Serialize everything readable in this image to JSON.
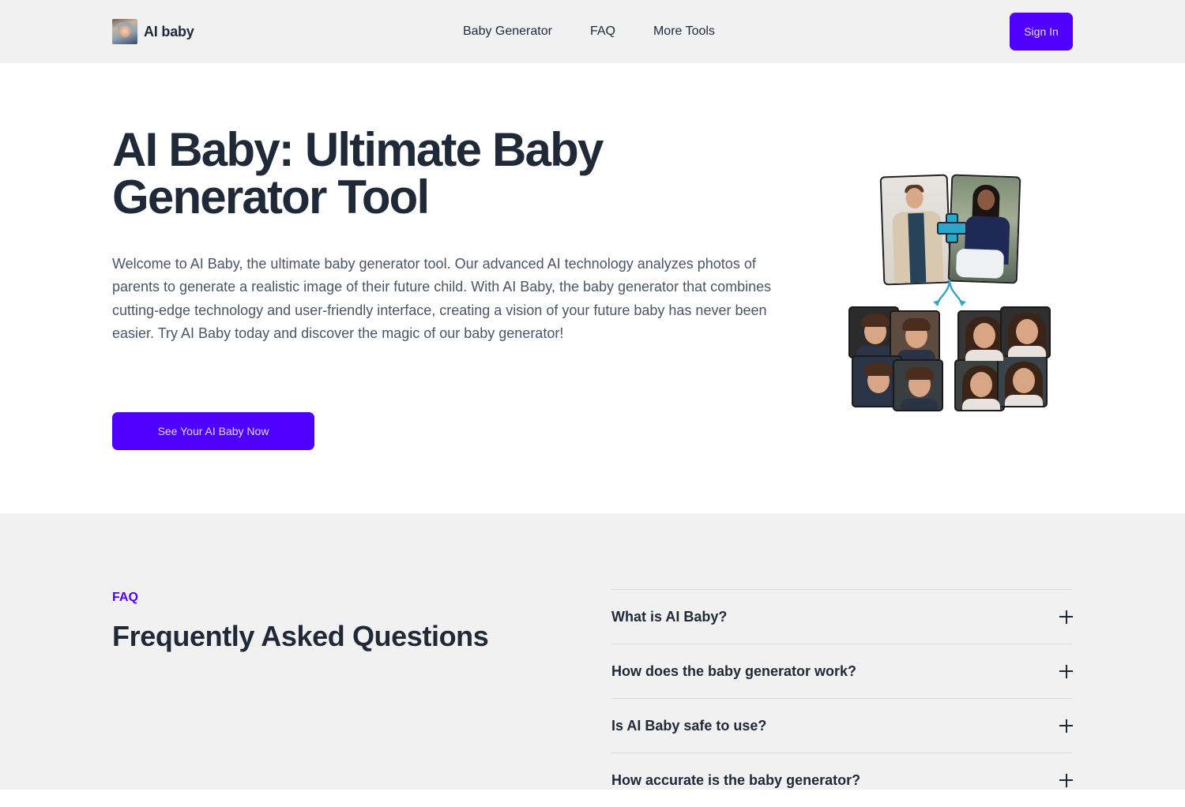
{
  "header": {
    "logo_text": "AI baby",
    "logo_icon": "baby-avatar-image",
    "nav": [
      {
        "label": "Baby Generator"
      },
      {
        "label": "FAQ"
      },
      {
        "label": "More Tools"
      }
    ],
    "signin_label": "Sign In"
  },
  "hero": {
    "title": "AI Baby: Ultimate Baby Generator Tool",
    "description": "Welcome to AI Baby, the ultimate baby generator tool. Our advanced AI technology analyzes photos of parents to generate a realistic image of their future child. With AI Baby, the baby generator that combines cutting-edge technology and user-friendly interface, creating a vision of your future baby has never been easier. Try AI Baby today and discover the magic of our baby generator!",
    "cta_label": "See Your AI Baby Now",
    "illustration": {
      "description": "parents photos combined with plus sign, arrows to generated boy and girl child portraits",
      "plus_icon": "plus-icon",
      "arrow_icon": "split-arrow-icon"
    }
  },
  "faq": {
    "eyebrow": "FAQ",
    "title": "Frequently Asked Questions",
    "items": [
      {
        "question": "What is AI Baby?",
        "icon": "plus-icon"
      },
      {
        "question": "How does the baby generator work?",
        "icon": "plus-icon"
      },
      {
        "question": "Is AI Baby safe to use?",
        "icon": "plus-icon"
      },
      {
        "question": "How accurate is the baby generator?",
        "icon": "plus-icon"
      }
    ]
  },
  "colors": {
    "accent": "#4f00ff",
    "header_bg": "#f1f1f1",
    "heading": "#1f2937",
    "body_text": "#4b5563",
    "faq_bg": "#f1f1f1"
  }
}
